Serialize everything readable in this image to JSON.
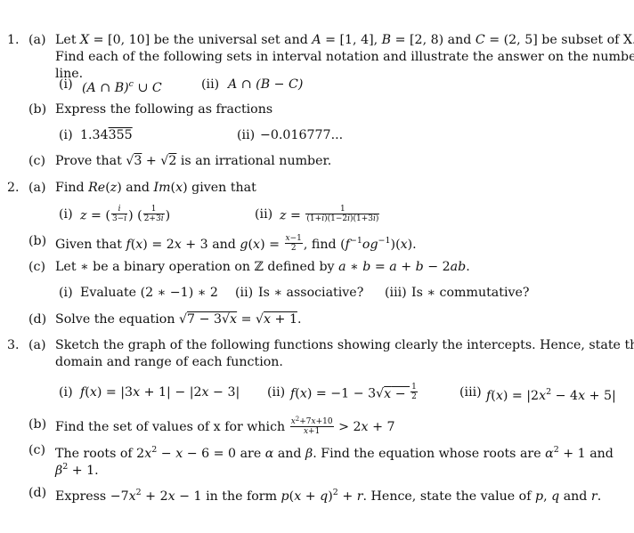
{
  "questions": [
    {
      "number": "1.",
      "parts": [
        {
          "label": "(a)",
          "text_lines": [
            "Let X = [0, 10] be the universal set and A = [1, 4], B = [2, 8) and C = (2, 5] be subset of X.",
            "Find each of the following sets in interval notation and illustrate the answer on the number",
            "line."
          ],
          "subparts": [
            {
              "label": "(i)",
              "expr": "(A ∩ B)ᶜ ∪ C"
            },
            {
              "label": "(ii)",
              "expr": "A ∩ (B − C)"
            }
          ]
        },
        {
          "label": "(b)",
          "text": "Express the following as fractions",
          "subparts": [
            {
              "label": "(i)",
              "expr_prefix": "1.34",
              "expr_repeating": "355"
            },
            {
              "label": "(ii)",
              "expr": "−0.016777..."
            }
          ]
        },
        {
          "label": "(c)",
          "text_prefix": "Prove that",
          "expr": "√3 + √2",
          "text_suffix": "is an irrational number."
        }
      ]
    },
    {
      "number": "2.",
      "parts": [
        {
          "label": "(a)",
          "text": "Find Re(z) and Im(x) given that",
          "subparts": [
            {
              "label": "(i)",
              "expr": "z = (i / (3−i)) (1 / (2+3i))"
            },
            {
              "label": "(ii)",
              "expr": "z = 1 / ((1+i)(1−2i)(1+3i))"
            }
          ]
        },
        {
          "label": "(b)",
          "text": "Given that f(x) = 2x + 3 and g(x) = (x−1)/2, find (f⁻¹og⁻¹)(x)."
        },
        {
          "label": "(c)",
          "text": "Let ∗ be a binary operation on ℤ defined by a ∗ b = a + b − 2ab.",
          "subparts": [
            {
              "label": "(i)",
              "text": "Evaluate (2 ∗ −1) ∗ 2"
            },
            {
              "label": "(ii)",
              "text": "Is ∗ associative?"
            },
            {
              "label": "(iii)",
              "text": "Is ∗ commutative?"
            }
          ]
        },
        {
          "label": "(d)",
          "text_prefix": "Solve the equation",
          "expr": "√(7 − 3√x) = √(x + 1)."
        }
      ]
    },
    {
      "number": "3.",
      "parts": [
        {
          "label": "(a)",
          "text_lines": [
            "Sketch the graph of the following functions showing clearly the intercepts. Hence, state the",
            "domain and range of each function."
          ],
          "subparts": [
            {
              "label": "(i)",
              "expr": "f(x) = |3x + 1| − |2x − 3|"
            },
            {
              "label": "(ii)",
              "expr": "f(x) = −1 − 3√(x − 1/2)"
            },
            {
              "label": "(iii)",
              "expr": "f(x) = |2x² − 4x + 5|"
            }
          ]
        },
        {
          "label": "(b)",
          "text_prefix": "Find the set of values of x for which",
          "expr": "(x² + 7x + 10)/(x + 1) > 2x + 7"
        },
        {
          "label": "(c)",
          "text_lines": [
            "The roots of 2x² − x − 6 = 0 are α and β. Find the equation whose roots are α² + 1 and",
            "β² + 1."
          ]
        },
        {
          "label": "(d)",
          "text": "Express −7x² + 2x − 1 in the form p(x + q)² + r. Hence, state the value of p, q and r."
        }
      ]
    }
  ]
}
